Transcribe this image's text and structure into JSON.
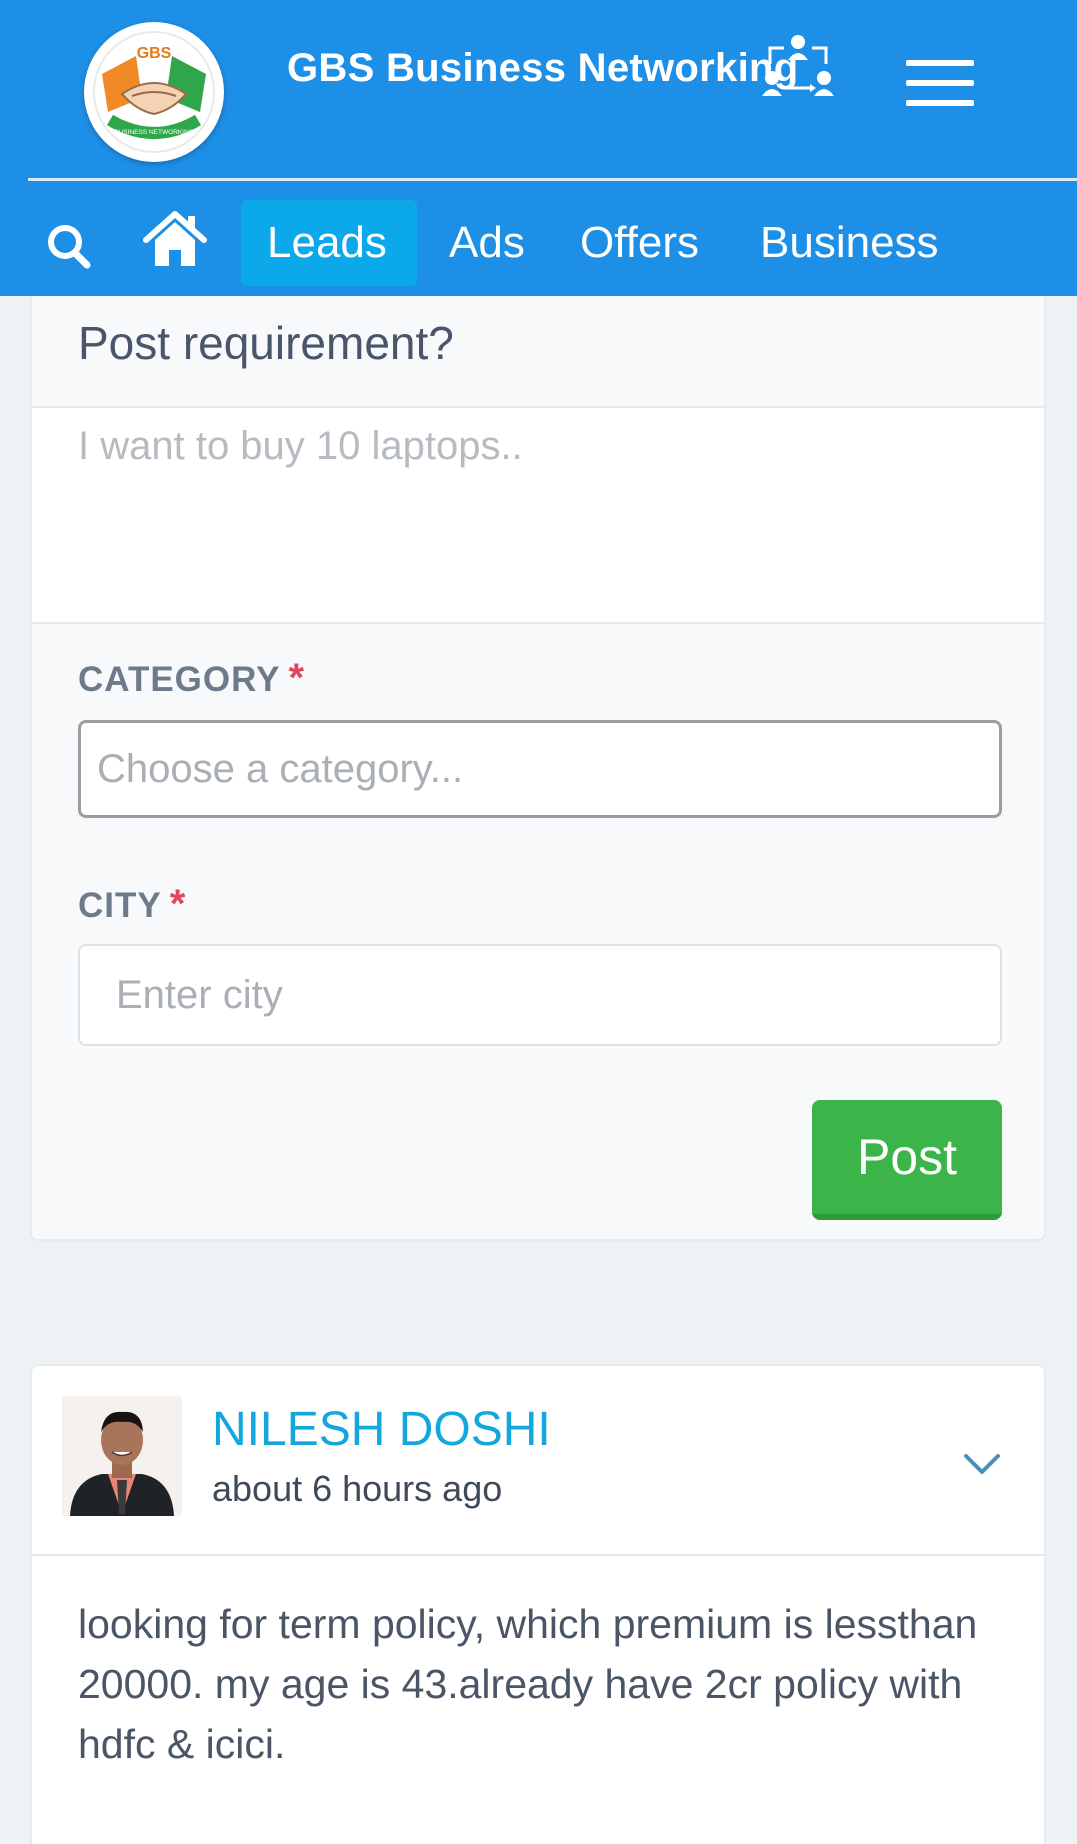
{
  "header": {
    "brand": "GBS Business Networking",
    "logo_text": "GBS",
    "logo_ribbon": "BUSINESS NETWORKING"
  },
  "nav": {
    "items": [
      "Leads",
      "Ads",
      "Offers",
      "Business"
    ],
    "active": "Leads"
  },
  "post_form": {
    "title": "Post requirement?",
    "requirement_placeholder": "I want to buy 10 laptops..",
    "category_label": "CATEGORY",
    "category_placeholder": "Choose a category...",
    "city_label": "CITY",
    "city_placeholder": "Enter city",
    "required_mark": "*",
    "submit_label": "Post"
  },
  "feed": {
    "posts": [
      {
        "author": "NILESH DOSHI",
        "time": "about 6 hours ago",
        "text": "looking for term policy, which premium is lessthan 20000. my age is 43.already have 2cr policy with hdfc & icici."
      }
    ]
  },
  "colors": {
    "brand_blue": "#1e8fe6",
    "active_tab": "#0ba8ea",
    "post_button": "#3bb54a",
    "author_link": "#14a7dd",
    "required_star": "#e0475e"
  },
  "icons": {
    "search": "search-icon",
    "home": "home-icon",
    "menu": "hamburger-menu-icon",
    "network": "network-people-icon",
    "dropdown": "chevron-down-icon"
  }
}
